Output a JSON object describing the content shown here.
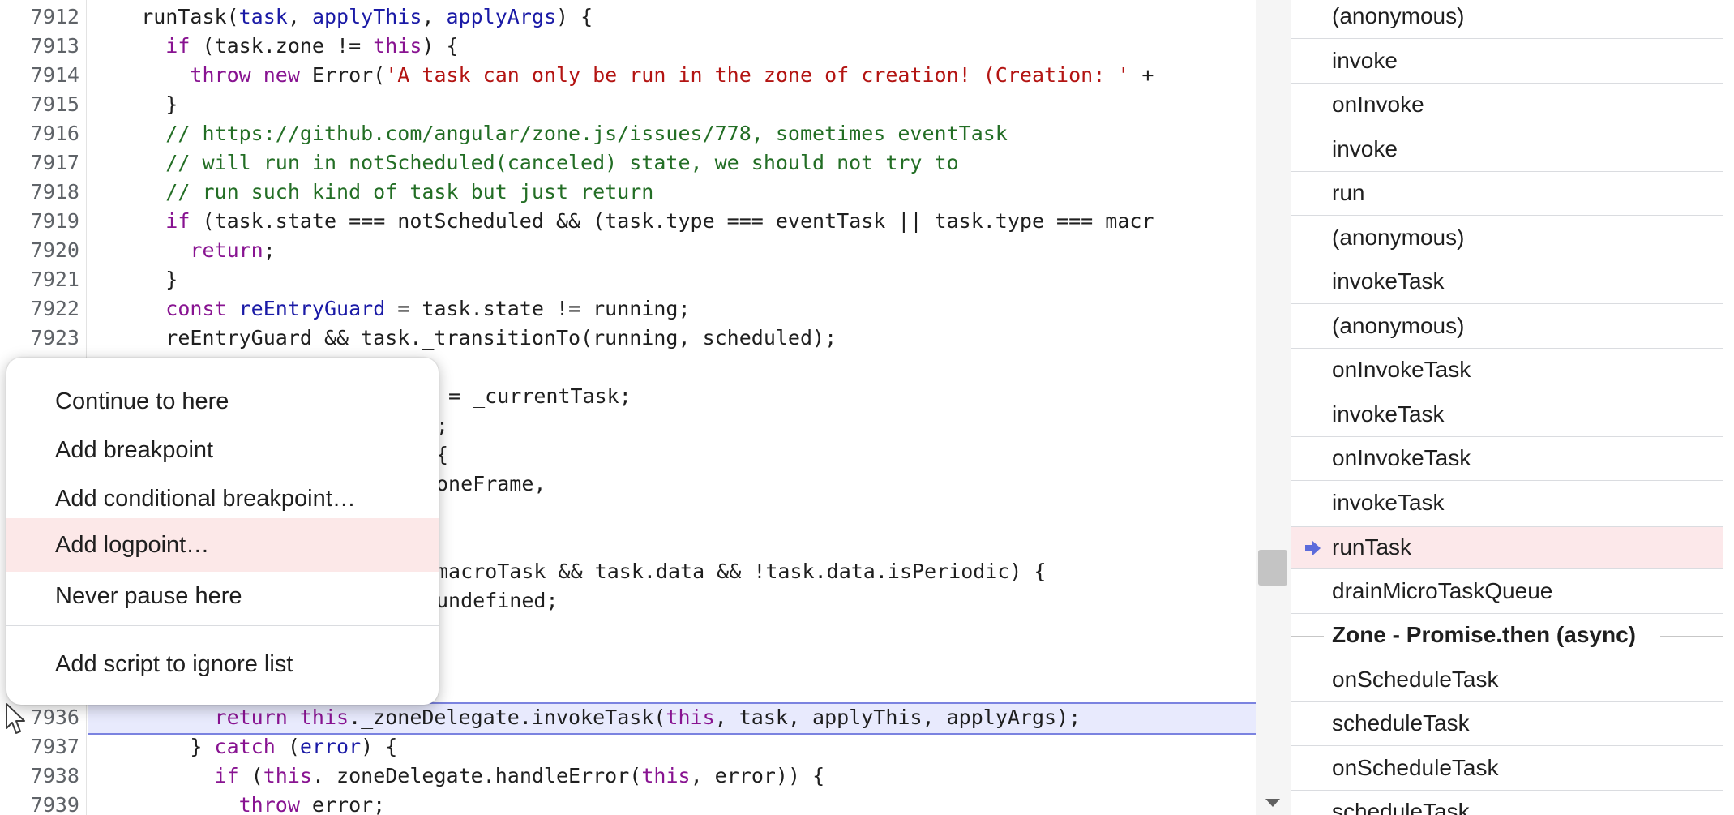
{
  "editor": {
    "lines": [
      {
        "num": "7912",
        "segs": [
          [
            "fn",
            "    runTask("
          ],
          [
            "param",
            "task"
          ],
          [
            "fn",
            ", "
          ],
          [
            "param",
            "applyThis"
          ],
          [
            "fn",
            ", "
          ],
          [
            "param",
            "applyArgs"
          ],
          [
            "fn",
            ") {"
          ]
        ]
      },
      {
        "num": "7913",
        "segs": [
          [
            "kw",
            "      if"
          ],
          [
            "fn",
            " (task.zone != "
          ],
          [
            "kw",
            "this"
          ],
          [
            "fn",
            ") {"
          ]
        ]
      },
      {
        "num": "7914",
        "segs": [
          [
            "kw",
            "        throw new"
          ],
          [
            "fn",
            " Error("
          ],
          [
            "str",
            "'A task can only be run in the zone of creation! (Creation: '"
          ],
          [
            "fn",
            " +"
          ]
        ]
      },
      {
        "num": "7915",
        "segs": [
          [
            "fn",
            "      }"
          ]
        ]
      },
      {
        "num": "7916",
        "segs": [
          [
            "cm",
            "      // https://github.com/angular/zone.js/issues/778, sometimes eventTask"
          ]
        ]
      },
      {
        "num": "7917",
        "segs": [
          [
            "cm",
            "      // will run in notScheduled(canceled) state, we should not try to"
          ]
        ]
      },
      {
        "num": "7918",
        "segs": [
          [
            "cm",
            "      // run such kind of task but just return"
          ]
        ]
      },
      {
        "num": "7919",
        "segs": [
          [
            "kw",
            "      if"
          ],
          [
            "fn",
            " (task.state === notScheduled && (task.type === eventTask || task.type === macr"
          ]
        ]
      },
      {
        "num": "7920",
        "segs": [
          [
            "kw",
            "        return"
          ],
          [
            "fn",
            ";"
          ]
        ]
      },
      {
        "num": "7921",
        "segs": [
          [
            "fn",
            "      }"
          ]
        ]
      },
      {
        "num": "7922",
        "segs": [
          [
            "kw",
            "      const"
          ],
          [
            "var",
            " reEntryGuard"
          ],
          [
            "fn",
            " = task.state != running;"
          ]
        ]
      },
      {
        "num": "7923",
        "segs": [
          [
            "fn",
            "      reEntryGuard && task._transitionTo(running, scheduled);"
          ]
        ]
      }
    ],
    "partial_lines": [
      {
        "text": "= _currentTask;"
      },
      {
        "text": ";"
      },
      {
        "text": "{"
      },
      {
        "text": "oneFrame,"
      },
      {
        "text": "macroTask && task.data && !task.data.isPeriodic) {"
      },
      {
        "text": "undefined;"
      }
    ],
    "lower_lines": [
      {
        "num": "7936",
        "segs": [
          [
            "kw",
            "          return this"
          ],
          [
            "fn",
            "._zoneDelegate.invokeTask("
          ],
          [
            "kw",
            "this"
          ],
          [
            "fn",
            ", task, applyThis, applyArgs);"
          ]
        ]
      },
      {
        "num": "7937",
        "segs": [
          [
            "fn",
            "        } "
          ],
          [
            "kw",
            "catch"
          ],
          [
            "fn",
            " ("
          ],
          [
            "param",
            "error"
          ],
          [
            "fn",
            ") {"
          ]
        ]
      },
      {
        "num": "7938",
        "segs": [
          [
            "kw",
            "          if"
          ],
          [
            "fn",
            " ("
          ],
          [
            "kw",
            "this"
          ],
          [
            "fn",
            "._zoneDelegate.handleError("
          ],
          [
            "kw",
            "this"
          ],
          [
            "fn",
            ", error)) {"
          ]
        ]
      },
      {
        "num": "7939",
        "segs": [
          [
            "kw",
            "            throw"
          ],
          [
            "fn",
            " error;"
          ]
        ]
      }
    ]
  },
  "context_menu": {
    "items": [
      {
        "label": "Continue to here"
      },
      {
        "label": "Add breakpoint"
      },
      {
        "label": "Add conditional breakpoint…"
      },
      {
        "label": "Add logpoint…"
      },
      {
        "label": "Never pause here"
      },
      {
        "label": "Add script to ignore list"
      }
    ],
    "hovered_item": "Add logpoint…"
  },
  "call_stack": {
    "frames_before": [
      "(anonymous)",
      "invoke",
      "onInvoke",
      "invoke",
      "run",
      "(anonymous)",
      "invokeTask",
      "(anonymous)",
      "onInvokeTask",
      "invokeTask",
      "onInvokeTask",
      "invokeTask"
    ],
    "current_frame": "runTask",
    "frames_after": [
      "drainMicroTaskQueue"
    ],
    "async_label": "Zone - Promise.then (async)",
    "async_frames": [
      "onScheduleTask",
      "scheduleTask",
      "onScheduleTask",
      "scheduleTask"
    ]
  },
  "colors": {
    "selected_frame_bg": "#fce8ea",
    "current_frame_arrow": "#5c6bdb",
    "exec_line_bg": "#e8eafd",
    "menu_hover_bg": "#fce8e8"
  }
}
